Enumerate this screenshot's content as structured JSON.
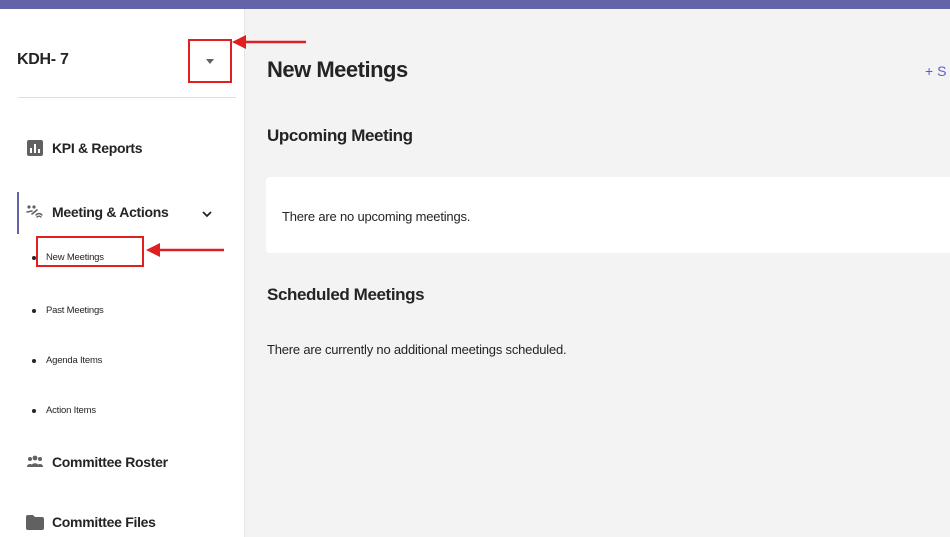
{
  "sidebar": {
    "team_name": "KDH- 7",
    "nav": {
      "kpi_label": "KPI & Reports",
      "meetings_label": "Meeting & Actions",
      "roster_label": "Committee Roster",
      "files_label": "Committee Files"
    },
    "sub_items": {
      "new_meetings": "New Meetings",
      "past_meetings": "Past Meetings",
      "agenda_items": "Agenda Items",
      "action_items": "Action Items"
    }
  },
  "main": {
    "title": "New Meetings",
    "add_button": "+ S",
    "upcoming": {
      "heading": "Upcoming Meeting",
      "empty_text": "There are no upcoming meetings."
    },
    "scheduled": {
      "heading": "Scheduled Meetings",
      "empty_text": "There are currently no additional meetings scheduled."
    }
  },
  "colors": {
    "brand": "#6264a7",
    "annotation_red": "#e02020"
  },
  "icons": {
    "kpi": "bar-chart-icon",
    "meetings": "meeting-icon",
    "roster": "people-icon",
    "files": "folder-icon",
    "dropdown": "caret-down-icon",
    "expand": "chevron-down-icon"
  }
}
